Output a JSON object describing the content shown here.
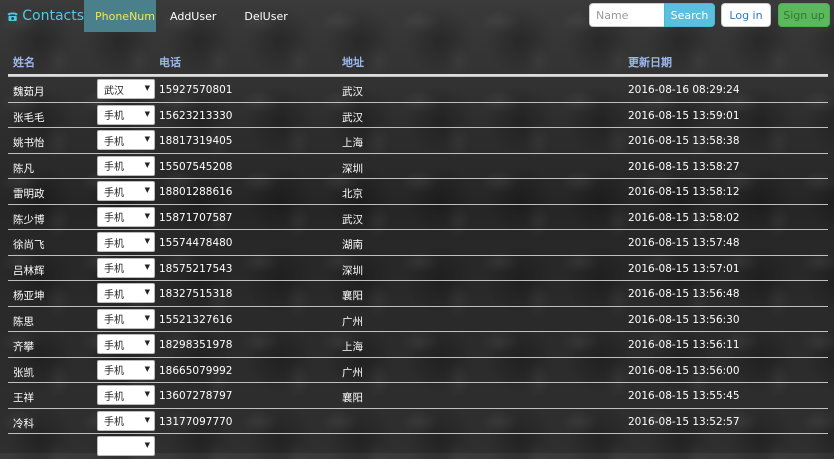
{
  "navbar": {
    "brand": "Contacts",
    "links": [
      {
        "label": "PhoneNum",
        "active": true
      },
      {
        "label": "AddUser",
        "active": false
      },
      {
        "label": "DelUser",
        "active": false
      }
    ],
    "search_placeholder": "Name",
    "search_label": "Search",
    "login_label": "Log in",
    "signup_label": "Sign up"
  },
  "table": {
    "headers": {
      "name": "姓名",
      "phone": "电话",
      "address": "地址",
      "updated": "更新日期"
    },
    "rows": [
      {
        "name": "魏茹月",
        "type": "武汉",
        "phone": "15927570801",
        "address": "武汉",
        "updated": "2016-08-16 08:29:24"
      },
      {
        "name": "张毛毛",
        "type": "手机",
        "phone": "15623213330",
        "address": "武汉",
        "updated": "2016-08-15 13:59:01"
      },
      {
        "name": "姚书怡",
        "type": "手机",
        "phone": "18817319405",
        "address": "上海",
        "updated": "2016-08-15 13:58:38"
      },
      {
        "name": "陈凡",
        "type": "手机",
        "phone": "15507545208",
        "address": "深圳",
        "updated": "2016-08-15 13:58:27"
      },
      {
        "name": "雷明政",
        "type": "手机",
        "phone": "18801288616",
        "address": "北京",
        "updated": "2016-08-15 13:58:12"
      },
      {
        "name": "陈少博",
        "type": "手机",
        "phone": "15871707587",
        "address": "武汉",
        "updated": "2016-08-15 13:58:02"
      },
      {
        "name": "徐尚飞",
        "type": "手机",
        "phone": "15574478480",
        "address": "湖南",
        "updated": "2016-08-15 13:57:48"
      },
      {
        "name": "吕林辉",
        "type": "手机",
        "phone": "18575217543",
        "address": "深圳",
        "updated": "2016-08-15 13:57:01"
      },
      {
        "name": "杨亚坤",
        "type": "手机",
        "phone": "18327515318",
        "address": "襄阳",
        "updated": "2016-08-15 13:56:48"
      },
      {
        "name": "陈思",
        "type": "手机",
        "phone": "15521327616",
        "address": "广州",
        "updated": "2016-08-15 13:56:30"
      },
      {
        "name": "齐攀",
        "type": "手机",
        "phone": "18298351978",
        "address": "上海",
        "updated": "2016-08-15 13:56:11"
      },
      {
        "name": "张凯",
        "type": "手机",
        "phone": "18665079992",
        "address": "广州",
        "updated": "2016-08-15 13:56:00"
      },
      {
        "name": "王祥",
        "type": "手机",
        "phone": "13607278797",
        "address": "襄阳",
        "updated": "2016-08-15 13:55:45"
      },
      {
        "name": "冷科",
        "type": "手机",
        "phone": "13177097770",
        "address": "",
        "updated": "2016-08-15 13:52:57"
      },
      {
        "name": "",
        "type": "",
        "phone": "",
        "address": "",
        "updated": ""
      }
    ]
  },
  "colors": {
    "brand": "#52c9e8",
    "active_nav_bg": "#4a7f8c",
    "active_nav_text": "#f3e94a",
    "header_text": "#9db8ec",
    "search_btn": "#5bc0de",
    "signup_btn": "#5cb85c"
  }
}
